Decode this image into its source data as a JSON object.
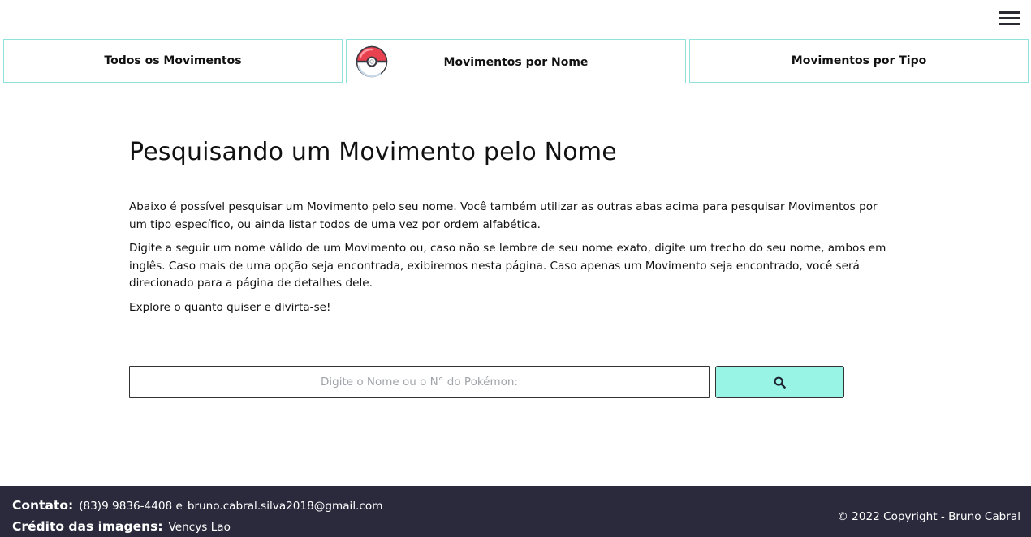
{
  "header": {
    "menu_icon": "hamburger-menu-icon"
  },
  "tabs": [
    {
      "label": "Todos os Movimentos"
    },
    {
      "label": "Movimentos por Nome",
      "icon": "pokeball-icon",
      "active": true
    },
    {
      "label": "Movimentos por Tipo"
    }
  ],
  "main": {
    "title": "Pesquisando um Movimento pelo Nome",
    "paragraphs": [
      "Abaixo é possível pesquisar um Movimento pelo seu nome. Você também utilizar as outras abas acima para pesquisar Movimentos por um tipo específico, ou ainda listar todos de uma vez por ordem alfabética.",
      "Digite a seguir um nome válido de um Movimento ou, caso não se lembre de seu nome exato, digite um trecho do seu nome, ambos em inglês. Caso mais de uma opção seja encontrada, exibiremos nesta página. Caso apenas um Movimento seja encontrado, você será direcionado para a página de detalhes dele.",
      "Explore o quanto quiser e divirta-se!"
    ]
  },
  "search": {
    "placeholder": "Digite o Nome ou o N° do Pokémon:",
    "value": "",
    "button_icon": "search-icon"
  },
  "footer": {
    "contact_label": "Contato:",
    "phone": "(83)9 9836-4408 e",
    "email": "bruno.cabral.silva2018@gmail.com",
    "credits_label": "Crédito das imagens:",
    "credits_value": "Vencys Lao",
    "copyright": "© 2022 Copyright - Bruno Cabral"
  },
  "colors": {
    "accent": "#98f5e6",
    "tab_border": "#8fe3dc",
    "footer_bg": "#2b2a3d",
    "pokeball_red": "#e8414f"
  }
}
